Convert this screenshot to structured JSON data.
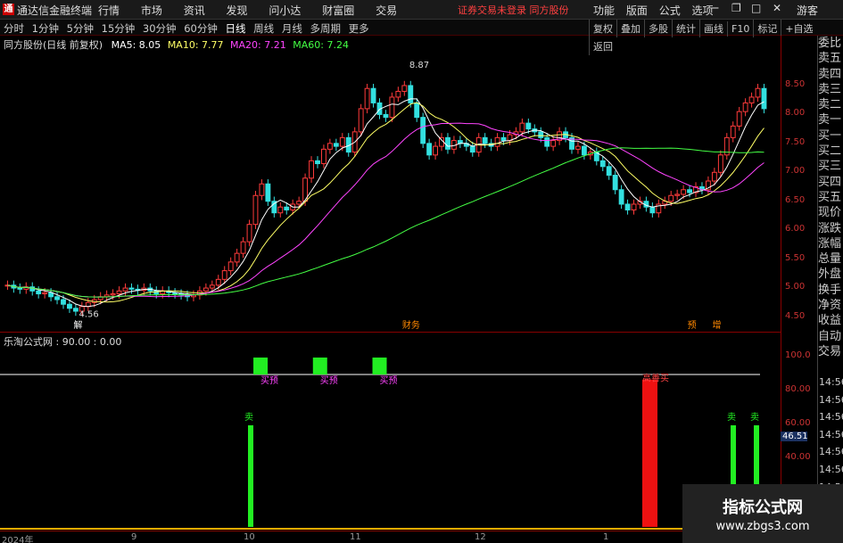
{
  "app": {
    "logo_char": "通",
    "name": "通达信金融终端",
    "menus": [
      "行情",
      "市场",
      "资讯",
      "发现",
      "问小达",
      "财富圈",
      "交易"
    ],
    "status": "证券交易未登录  同方股份",
    "right_menus": [
      "功能",
      "版面",
      "公式",
      "选项"
    ],
    "guest": "游客"
  },
  "toolbar": {
    "periods": [
      "分时",
      "1分钟",
      "5分钟",
      "15分钟",
      "30分钟",
      "60分钟",
      "日线",
      "周线",
      "月线",
      "多周期",
      "更多"
    ],
    "active_period": "日线",
    "right_buttons": [
      "复权",
      "叠加",
      "多股",
      "统计",
      "画线",
      "F10",
      "标记",
      "+自选",
      "返回"
    ]
  },
  "main_chart": {
    "title": "同方股份(日线 前复权)",
    "ma_legend": [
      {
        "label": "MA5: 8.05",
        "color": "#ffffff"
      },
      {
        "label": "MA10: 7.77",
        "color": "#ffff66"
      },
      {
        "label": "MA20: 7.21",
        "color": "#ff44ff"
      },
      {
        "label": "MA60: 7.24",
        "color": "#44ff44"
      }
    ],
    "high_label": "8.87",
    "low_label": "4.56",
    "event_labels": [
      "解",
      "财务",
      "预",
      "增"
    ],
    "price_ticks": [
      "8.50",
      "8.00",
      "7.50",
      "7.00",
      "6.50",
      "6.00",
      "5.50",
      "5.00",
      "4.50"
    ]
  },
  "indicator": {
    "title": "乐淘公式网 : 90.00 : 0.00",
    "ticks": [
      "100.0",
      "80.00",
      "60.00",
      "40.00"
    ],
    "current_value": "46.51",
    "buy_label": "买预",
    "sell_label": "卖",
    "sell_top_label": "高善买"
  },
  "xaxis": {
    "labels": [
      "2024年",
      "9",
      "10",
      "11",
      "12",
      "1"
    ]
  },
  "sidebar": {
    "top": "委比",
    "items": [
      "委比",
      "卖五",
      "卖四",
      "卖三",
      "卖二",
      "卖一",
      "买一",
      "买二",
      "买三",
      "买四",
      "买五",
      "现价",
      "涨跌",
      "涨幅",
      "总量",
      "外盘",
      "换手",
      "净资",
      "收益",
      "自动",
      "交易"
    ]
  },
  "times": [
    "14:56",
    "14:56",
    "14:56",
    "14:56",
    "14:56",
    "14:56",
    "14:56",
    "14:56",
    "14:56"
  ],
  "watermark": {
    "line1": "指标公式网",
    "line2": "www.zbgs3.com"
  },
  "chart_data": {
    "type": "candlestick",
    "title": "同方股份(日线 前复权)",
    "closes": [
      5.05,
      5.0,
      4.98,
      5.02,
      4.95,
      4.9,
      4.92,
      4.85,
      4.8,
      4.72,
      4.65,
      4.6,
      4.68,
      4.75,
      4.8,
      4.85,
      4.88,
      4.9,
      4.95,
      5.0,
      4.98,
      4.96,
      5.0,
      4.95,
      4.9,
      4.95,
      4.92,
      4.9,
      4.88,
      4.85,
      4.88,
      4.95,
      5.0,
      5.05,
      5.15,
      5.3,
      5.45,
      5.6,
      5.8,
      6.1,
      6.6,
      6.8,
      6.5,
      6.3,
      6.4,
      6.35,
      6.45,
      6.5,
      6.9,
      7.2,
      7.15,
      7.4,
      7.5,
      7.45,
      7.6,
      7.35,
      7.7,
      8.1,
      8.45,
      8.2,
      8.0,
      7.95,
      8.3,
      8.4,
      8.5,
      8.2,
      7.95,
      7.5,
      7.3,
      7.45,
      7.6,
      7.4,
      7.55,
      7.5,
      7.45,
      7.35,
      7.6,
      7.5,
      7.45,
      7.6,
      7.55,
      7.65,
      7.7,
      7.85,
      7.75,
      7.7,
      7.6,
      7.45,
      7.55,
      7.7,
      7.6,
      7.4,
      7.45,
      7.3,
      7.35,
      7.2,
      7.1,
      6.95,
      6.7,
      6.45,
      6.35,
      6.45,
      6.5,
      6.4,
      6.3,
      6.45,
      6.5,
      6.6,
      6.62,
      6.7,
      6.65,
      6.75,
      6.7,
      6.85,
      7.0,
      7.3,
      7.6,
      7.8,
      8.05,
      8.2,
      8.3,
      8.45,
      8.1
    ],
    "ma5_last": 8.05,
    "ma10_last": 7.77,
    "ma20_last": 7.21,
    "ma60_last": 7.24,
    "ylim": [
      4.4,
      8.9
    ],
    "indicator": {
      "buy_signals": [
        25,
        31,
        37
      ],
      "sell_signals": [
        22,
        74,
        78
      ],
      "red_bar": {
        "index": 64,
        "value": 87
      },
      "threshold": 90
    }
  }
}
